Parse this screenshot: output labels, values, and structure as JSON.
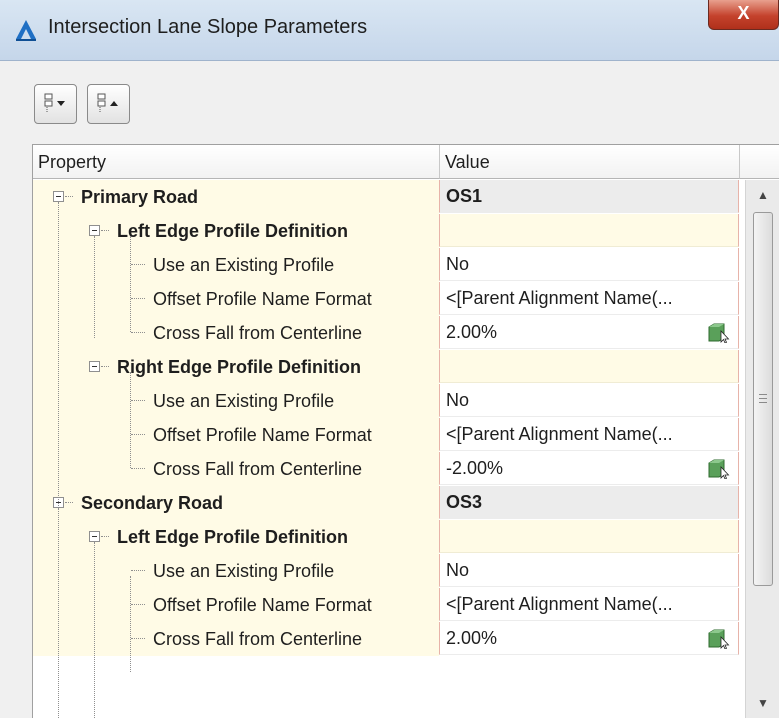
{
  "window": {
    "title": "Intersection Lane Slope Parameters",
    "close_label": "X"
  },
  "toolbar": {
    "expand_all_icon": "expand-all-icon",
    "collapse_all_icon": "collapse-all-icon"
  },
  "grid": {
    "columns": [
      "Property",
      "Value"
    ],
    "rows": [
      {
        "label": "Primary Road",
        "value": "OS1"
      },
      {
        "label": "Left Edge Profile Definition",
        "value": ""
      },
      {
        "label": "Use an Existing Profile",
        "value": "No"
      },
      {
        "label": "Offset Profile Name Format",
        "value": "<[Parent Alignment Name(..."
      },
      {
        "label": "Cross Fall from Centerline",
        "value": "2.00%"
      },
      {
        "label": "Right Edge Profile Definition",
        "value": ""
      },
      {
        "label": "Use an Existing Profile",
        "value": "No"
      },
      {
        "label": "Offset Profile Name Format",
        "value": "<[Parent Alignment Name(..."
      },
      {
        "label": "Cross Fall from Centerline",
        "value": "-2.00%"
      },
      {
        "label": "Secondary Road",
        "value": "OS3"
      },
      {
        "label": "Left Edge Profile Definition",
        "value": ""
      },
      {
        "label": "Use an Existing Profile",
        "value": "No"
      },
      {
        "label": "Offset Profile Name Format",
        "value": "<[Parent Alignment Name(..."
      },
      {
        "label": "Cross Fall from Centerline",
        "value": "2.00%"
      }
    ]
  },
  "colors": {
    "property_background": "#fffbe6",
    "value_border": "#e7b3a9",
    "group_value_background": "#ececec",
    "edit_icon_green": "#5aa05a"
  },
  "icons": {
    "app": "autodesk-logo-icon",
    "expander": "collapse-minus-icon",
    "edit": "edit-value-icon"
  }
}
